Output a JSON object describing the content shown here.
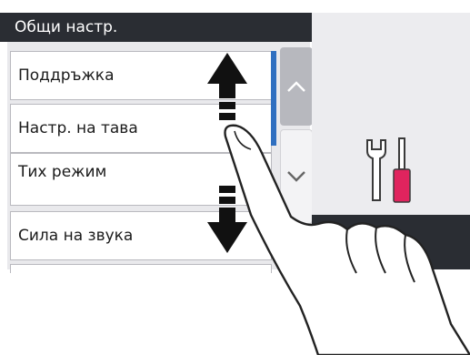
{
  "header": {
    "title": "Общи настр."
  },
  "menu": {
    "items": [
      {
        "label": "Поддръжка"
      },
      {
        "label": "Настр. на тава"
      },
      {
        "label": "Тих режим"
      },
      {
        "label": "Сила на звука"
      }
    ]
  },
  "scroll": {
    "up_icon": "chevron-up-icon",
    "down_icon": "chevron-down-icon"
  },
  "illustration": {
    "gesture": "swipe-up-down",
    "icon": "tools-icon"
  },
  "colors": {
    "title_bar": "#2a2d33",
    "scroll_indicator": "#2f6fc0",
    "screwdriver_handle": "#e0245e"
  }
}
